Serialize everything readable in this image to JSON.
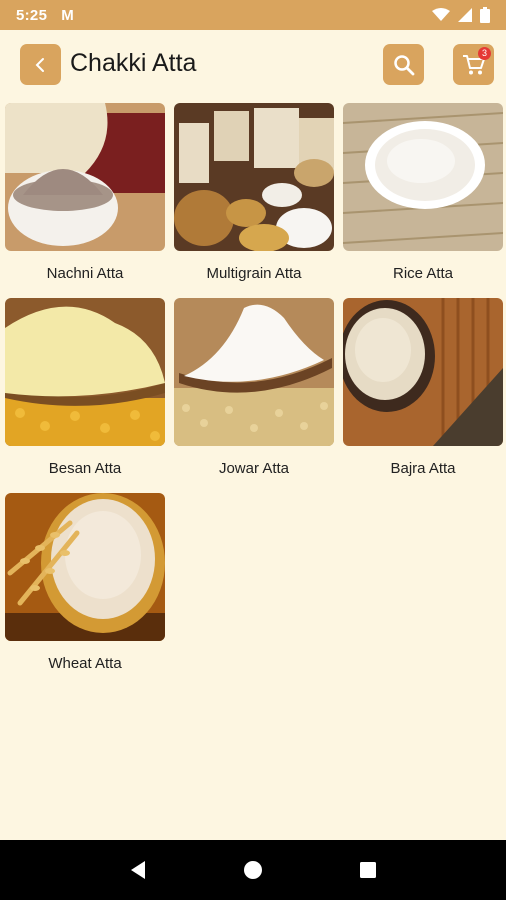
{
  "status_bar": {
    "time": "5:25",
    "mail_icon": "gmail-icon",
    "icons": [
      "wifi-icon",
      "signal-icon",
      "battery-icon"
    ]
  },
  "app_bar": {
    "title": "Chakki Atta",
    "back_icon": "chevron-left-icon",
    "search_icon": "search-icon",
    "cart_icon": "cart-icon",
    "cart_count": "3"
  },
  "products": [
    {
      "name": "Nachni Atta"
    },
    {
      "name": "Multigrain Atta"
    },
    {
      "name": "Rice Atta"
    },
    {
      "name": "Besan Atta"
    },
    {
      "name": "Jowar Atta"
    },
    {
      "name": "Bajra Atta"
    },
    {
      "name": "Wheat Atta"
    }
  ],
  "nav_bar": {
    "icons": [
      "back-triangle-icon",
      "home-circle-icon",
      "recents-square-icon"
    ]
  },
  "colors": {
    "accent": "#D9A45E",
    "background": "#FDF6E1",
    "badge": "#E53935"
  }
}
